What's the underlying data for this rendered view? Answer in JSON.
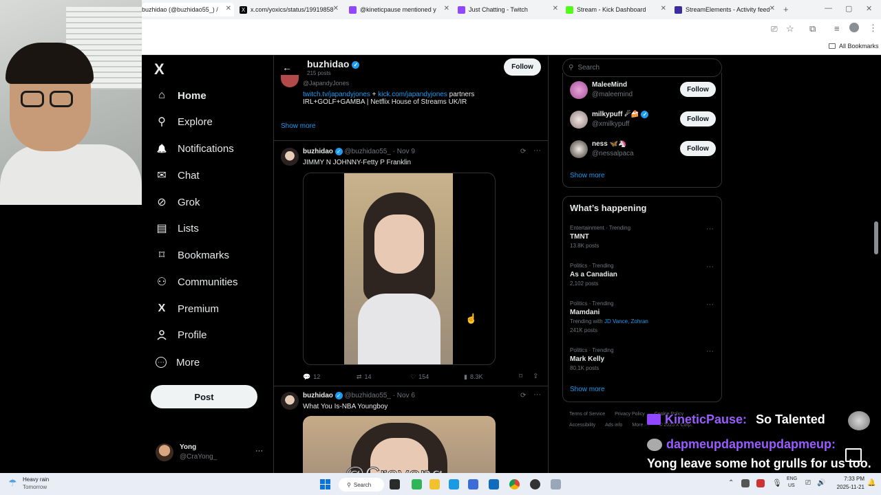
{
  "browser": {
    "tabs": [
      {
        "title": "buzhidao (@buzhidao55_) /",
        "active": true
      },
      {
        "title": "x.com/yoxics/status/19919858",
        "active": false
      },
      {
        "title": "@kineticpause mentioned y",
        "active": false
      },
      {
        "title": "Just Chatting - Twitch",
        "active": false
      },
      {
        "title": "Stream - Kick Dashboard",
        "active": false
      },
      {
        "title": "StreamElements - Activity feed",
        "active": false
      }
    ],
    "new_tab": "+",
    "bookmarks_label": "All Bookmarks"
  },
  "nav": {
    "logo": "X",
    "items": [
      {
        "label": "Home",
        "icon": "home-icon",
        "glyph": "⌂"
      },
      {
        "label": "Explore",
        "icon": "search-icon",
        "glyph": "⚲"
      },
      {
        "label": "Notifications",
        "icon": "bell-icon",
        "glyph": "🔔"
      },
      {
        "label": "Chat",
        "icon": "mail-icon",
        "glyph": "✉"
      },
      {
        "label": "Grok",
        "icon": "grok-icon",
        "glyph": "⊘"
      },
      {
        "label": "Lists",
        "icon": "list-icon",
        "glyph": "▤"
      },
      {
        "label": "Bookmarks",
        "icon": "bookmark-icon",
        "glyph": "⌑"
      },
      {
        "label": "Communities",
        "icon": "people-icon",
        "glyph": "⚇"
      },
      {
        "label": "Premium",
        "icon": "x-icon",
        "glyph": "X"
      },
      {
        "label": "Profile",
        "icon": "person-icon",
        "glyph": "⚲"
      },
      {
        "label": "More",
        "icon": "more-circle-icon",
        "glyph": "⋯"
      }
    ],
    "post_label": "Post",
    "account": {
      "name": "Yong",
      "handle": "@CraYong_",
      "menu": "···"
    }
  },
  "profile_header": {
    "name": "buzhidao",
    "posts_count": "215 posts",
    "follow_label": "Follow"
  },
  "bio_card": {
    "handle": "@JapandyJones",
    "link1": "twitch.tv/japandyjones",
    "plus": "+",
    "link2": "kick.com/japandyjones",
    "text1": "partners",
    "text2": "IRL+GOLF+GAMBA | Netflix House of Streams UK/IR",
    "show_more": "Show more"
  },
  "posts": [
    {
      "name": "buzhidao",
      "handle": "@buzhidao55_",
      "date": "· Nov 9",
      "text": "JIMMY N JOHNNY-Fetty P Franklin",
      "replies": "12",
      "reposts": "14",
      "likes": "154",
      "views": "8.3K"
    },
    {
      "name": "buzhidao",
      "handle": "@buzhidao55_",
      "date": "· Nov 6",
      "text": "What You Is-NBA Youngboy"
    }
  ],
  "right": {
    "search_placeholder": "Search",
    "who_to_follow": [
      {
        "name": "MaleeMind",
        "handle": "@maleemind",
        "follow": "Follow"
      },
      {
        "name": "milkypuff ☄🍰",
        "handle": "@xmilkypuff",
        "follow": "Follow"
      },
      {
        "name": "ness 🦋🦄",
        "handle": "@nessalpaca",
        "follow": "Follow"
      }
    ],
    "show_more": "Show more",
    "happening_title": "What’s happening",
    "trends": [
      {
        "meta": "Entertainment · Trending",
        "title": "TMNT",
        "count": "13.8K posts"
      },
      {
        "meta": "Politics · Trending",
        "title": "As a Canadian",
        "count": "2,102 posts"
      },
      {
        "meta": "Politics · Trending",
        "title": "Mamdani",
        "with_prefix": "Trending with",
        "with_names": "JD Vance, Zohran",
        "count": "241K posts"
      },
      {
        "meta": "Politics · Trending",
        "title": "Mark Kelly",
        "count": "80.1K posts"
      }
    ],
    "show_more2": "Show more",
    "footer1": [
      "Terms of Service",
      "Privacy Policy",
      "Cookie Policy"
    ],
    "footer2": [
      "Accessibility",
      "Ads info",
      "More ···",
      "© 2025 X Corp."
    ]
  },
  "overlay": {
    "chat": [
      {
        "user": "KineticPause:",
        "message": "So Talented"
      },
      {
        "user": "dapmeupdapmeupdapmeup:",
        "message": "Yong leave some hot grulls for us too."
      }
    ],
    "watermark": "@Crayong"
  },
  "taskbar": {
    "weather_title": "Heavy rain",
    "weather_sub": "Tomorrow",
    "search_label": "Search",
    "lang1": "ENG",
    "lang2": "US",
    "time": "7:33 PM",
    "date": "2025-11-21"
  },
  "colors": {
    "accent": "#1d9bf0",
    "twitch_purple": "#9146ff",
    "kick_green": "#53fc18"
  }
}
